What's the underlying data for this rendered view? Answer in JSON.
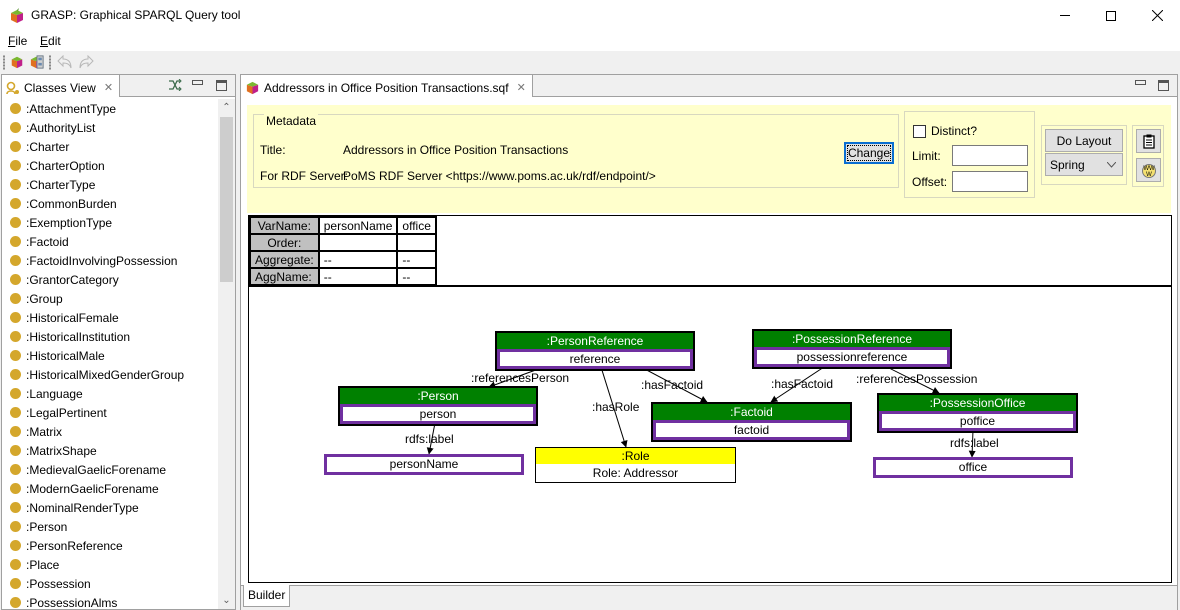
{
  "window": {
    "title": "GRASP: Graphical SPARQL Query tool",
    "controls": [
      "minimize",
      "maximize",
      "close"
    ]
  },
  "menu": {
    "items": [
      {
        "label": "File",
        "mnemonic": "F"
      },
      {
        "label": "Edit",
        "mnemonic": "E"
      }
    ]
  },
  "toolbar": {
    "buttons": [
      "new-query-icon",
      "open-query-icon",
      "undo-icon",
      "redo-icon"
    ]
  },
  "classes_view": {
    "tab_label": "Classes View",
    "items": [
      ":AttachmentType",
      ":AuthorityList",
      ":Charter",
      ":CharterOption",
      ":CharterType",
      ":CommonBurden",
      ":ExemptionType",
      ":Factoid",
      ":FactoidInvolvingPossession",
      ":GrantorCategory",
      ":Group",
      ":HistoricalFemale",
      ":HistoricalInstitution",
      ":HistoricalMale",
      ":HistoricalMixedGenderGroup",
      ":Language",
      ":LegalPertinent",
      ":Matrix",
      ":MatrixShape",
      ":MedievalGaelicForename",
      ":ModernGaelicForename",
      ":NominalRenderType",
      ":Person",
      ":PersonReference",
      ":Place",
      ":Possession",
      ":PossessionAlms"
    ],
    "scroll_position": 0.0
  },
  "editor": {
    "tab_label": "Addressors in Office Position Transactions.sqf",
    "metadata": {
      "legend": "Metadata",
      "title_label": "Title:",
      "title_value": "Addressors in Office Position Transactions",
      "server_label": "For RDF Server:",
      "server_value": "PoMS RDF Server <https://www.poms.ac.uk/rdf/endpoint/>",
      "change_button": "Change"
    },
    "options": {
      "distinct_label": "Distinct?",
      "distinct_checked": false,
      "limit_label": "Limit:",
      "limit_value": "",
      "offset_label": "Offset:",
      "offset_value": ""
    },
    "layout": {
      "do_layout_button": "Do Layout",
      "algorithm_selected": "Spring"
    },
    "var_table": {
      "row_headers": [
        "VarName:",
        "Order:",
        "Aggregate:",
        "AggName:"
      ],
      "columns": [
        {
          "varname": "personName",
          "order": "",
          "aggregate": "--",
          "aggname": "--"
        },
        {
          "varname": "office",
          "order": "",
          "aggregate": "--",
          "aggname": "--"
        }
      ]
    },
    "graph": {
      "nodes": [
        {
          "id": "personref",
          "class": ":PersonReference",
          "var": "reference"
        },
        {
          "id": "possref",
          "class": ":PossessionReference",
          "var": "possessionreference"
        },
        {
          "id": "person",
          "class": ":Person",
          "var": "person"
        },
        {
          "id": "factoid",
          "class": ":Factoid",
          "var": "factoid"
        },
        {
          "id": "possoffice",
          "class": ":PossessionOffice",
          "var": "poffice"
        },
        {
          "id": "personName",
          "var": "personName"
        },
        {
          "id": "role",
          "class": ":Role",
          "value": "Role: Addressor"
        },
        {
          "id": "office",
          "var": "office"
        }
      ],
      "edges": [
        {
          "from": "personref",
          "to": "person",
          "label": ":referencesPerson"
        },
        {
          "from": "personref",
          "to": "role",
          "label": ":hasRole"
        },
        {
          "from": "personref",
          "to": "factoid",
          "label": ":hasFactoid"
        },
        {
          "from": "possref",
          "to": "factoid",
          "label": ":hasFactoid"
        },
        {
          "from": "possref",
          "to": "possoffice",
          "label": ":referencesPossession"
        },
        {
          "from": "person",
          "to": "personName",
          "label": "rdfs:label"
        },
        {
          "from": "possoffice",
          "to": "office",
          "label": "rdfs:label"
        }
      ]
    },
    "bottom_tab": "Builder"
  },
  "colors": {
    "class_header": "#008000",
    "variable_border": "#7030a0",
    "literal_header": "#ffff00",
    "header_panel": "#ffffcc",
    "class_dot": "#d4a72c",
    "focus_blue": "#0a6ed1"
  }
}
